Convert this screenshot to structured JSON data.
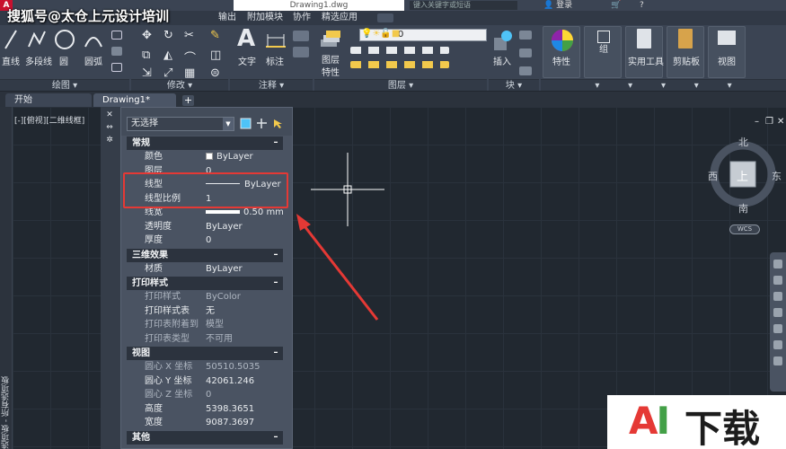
{
  "watermark": "搜狐号@太仓上元设计培训",
  "titlebar": {
    "logo": "A",
    "document": "Drawing1.dwg",
    "search_placeholder": "键入关键字或短语",
    "login": "登录"
  },
  "menu": {
    "items": [
      "输出",
      "附加模块",
      "协作",
      "精选应用"
    ]
  },
  "ribbon": {
    "draw_tools": [
      "直线",
      "多段线",
      "圆",
      "圆弧"
    ],
    "annotation_tools": [
      "文字",
      "标注"
    ],
    "layer_tools": [
      "图层",
      "特性"
    ],
    "layer_current": "0",
    "block_tool": "插入",
    "properties_tool": "特性",
    "group_tool": "组",
    "utilities_tool": "实用工具",
    "clipboard_tool": "剪贴板",
    "view_tool": "视图",
    "panels": [
      "绘图",
      "修改",
      "注释",
      "图层",
      "块"
    ]
  },
  "tabs": {
    "start": "开始",
    "drawing": "Drawing1*",
    "add": "+"
  },
  "viewport_label": "[-][俯视][二维线框]",
  "left_strip_text": "工具选项板 - 所有选项板",
  "palette_strip": {
    "close": "✕",
    "autohide": "⇔",
    "settings": "✲"
  },
  "properties": {
    "selection": "无选择",
    "sections": [
      {
        "title": "常规",
        "rows": [
          {
            "label": "颜色",
            "value": "ByLayer",
            "kind": "color"
          },
          {
            "label": "图层",
            "value": "0"
          },
          {
            "label": "线型",
            "value": "ByLayer",
            "kind": "linetype"
          },
          {
            "label": "线型比例",
            "value": "1"
          },
          {
            "label": "线宽",
            "value": "0.50 mm",
            "kind": "lineweight"
          },
          {
            "label": "透明度",
            "value": "ByLayer"
          },
          {
            "label": "厚度",
            "value": "0"
          }
        ]
      },
      {
        "title": "三维效果",
        "rows": [
          {
            "label": "材质",
            "value": "ByLayer"
          }
        ]
      },
      {
        "title": "打印样式",
        "rows": [
          {
            "label": "打印样式",
            "value": "ByColor",
            "dim": true
          },
          {
            "label": "打印样式表",
            "value": "无"
          },
          {
            "label": "打印表附着到",
            "value": "模型",
            "dim": true
          },
          {
            "label": "打印表类型",
            "value": "不可用",
            "dim": true
          }
        ]
      },
      {
        "title": "视图",
        "rows": [
          {
            "label": "圆心 X 坐标",
            "value": "50510.5035",
            "dim": true
          },
          {
            "label": "圆心 Y 坐标",
            "value": "42061.246"
          },
          {
            "label": "圆心 Z 坐标",
            "value": "0",
            "dim": true
          },
          {
            "label": "高度",
            "value": "5398.3651"
          },
          {
            "label": "宽度",
            "value": "9087.3697"
          }
        ]
      },
      {
        "title": "其他",
        "rows": []
      }
    ]
  },
  "viewcube": {
    "north": "北",
    "south": "南",
    "east": "东",
    "west": "西",
    "face": "上",
    "wcs": "WCS"
  },
  "viewport_controls": {
    "minimize": "–",
    "restore": "❐",
    "close": "✕"
  },
  "logo": {
    "a": "A",
    "i": "I",
    "text": "下载"
  }
}
